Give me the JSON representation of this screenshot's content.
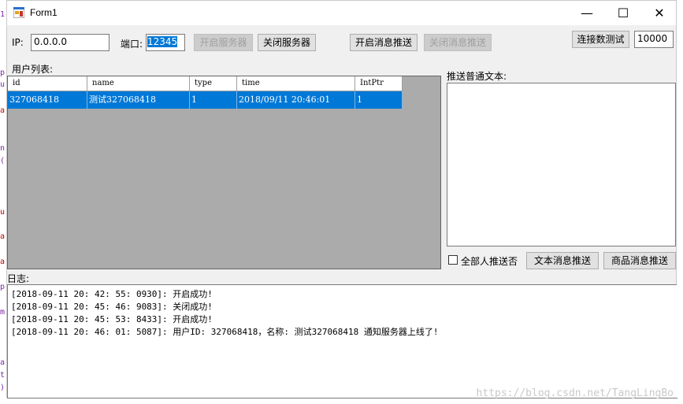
{
  "window": {
    "title": "Form1",
    "minimize": "—",
    "maximize": "☐",
    "close": "✕"
  },
  "strip_glyphs": [
    "1",
    "p",
    "u",
    "a",
    "n",
    "(",
    "u",
    "a",
    "a",
    "p",
    "m",
    "a",
    "t",
    ")"
  ],
  "toolbar": {
    "ip_label": "IP:",
    "ip_value": "0.0.0.0",
    "port_label": "端口:",
    "port_value": "12345",
    "start_server": "开启服务器",
    "stop_server": "关闭服务器",
    "start_push": "开启消息推送",
    "stop_push": "关闭消息推送",
    "connect_test": "连接数测试",
    "connect_count": "10000"
  },
  "users": {
    "label": "用户列表:",
    "columns": [
      "id",
      "name",
      "type",
      "time",
      "IntPtr"
    ],
    "rows": [
      [
        "327068418",
        "测试327068418",
        "1",
        "2018/09/11 20:46:01",
        "1"
      ]
    ]
  },
  "send": {
    "label": "推送普通文本:",
    "text": "",
    "push_all_label": "全部人推送否",
    "text_push": "文本消息推送",
    "goods_push": "商品消息推送"
  },
  "log": {
    "label": "日志:",
    "lines": [
      "[2018-09-11 20: 42: 55: 0930]: 开启成功!",
      "[2018-09-11 20: 45: 46: 9083]: 关闭成功!",
      "[2018-09-11 20: 45: 53: 8433]: 开启成功!",
      "[2018-09-11 20: 46: 01: 5087]: 用户ID: 327068418，名称: 测试327068418 通知服务器上线了!"
    ]
  },
  "watermark": "https://blog.csdn.net/TangLingBo",
  "colors": {
    "selection": "#0078d7",
    "grid_bg": "#ababab",
    "form_bg": "#f0f0f0"
  }
}
